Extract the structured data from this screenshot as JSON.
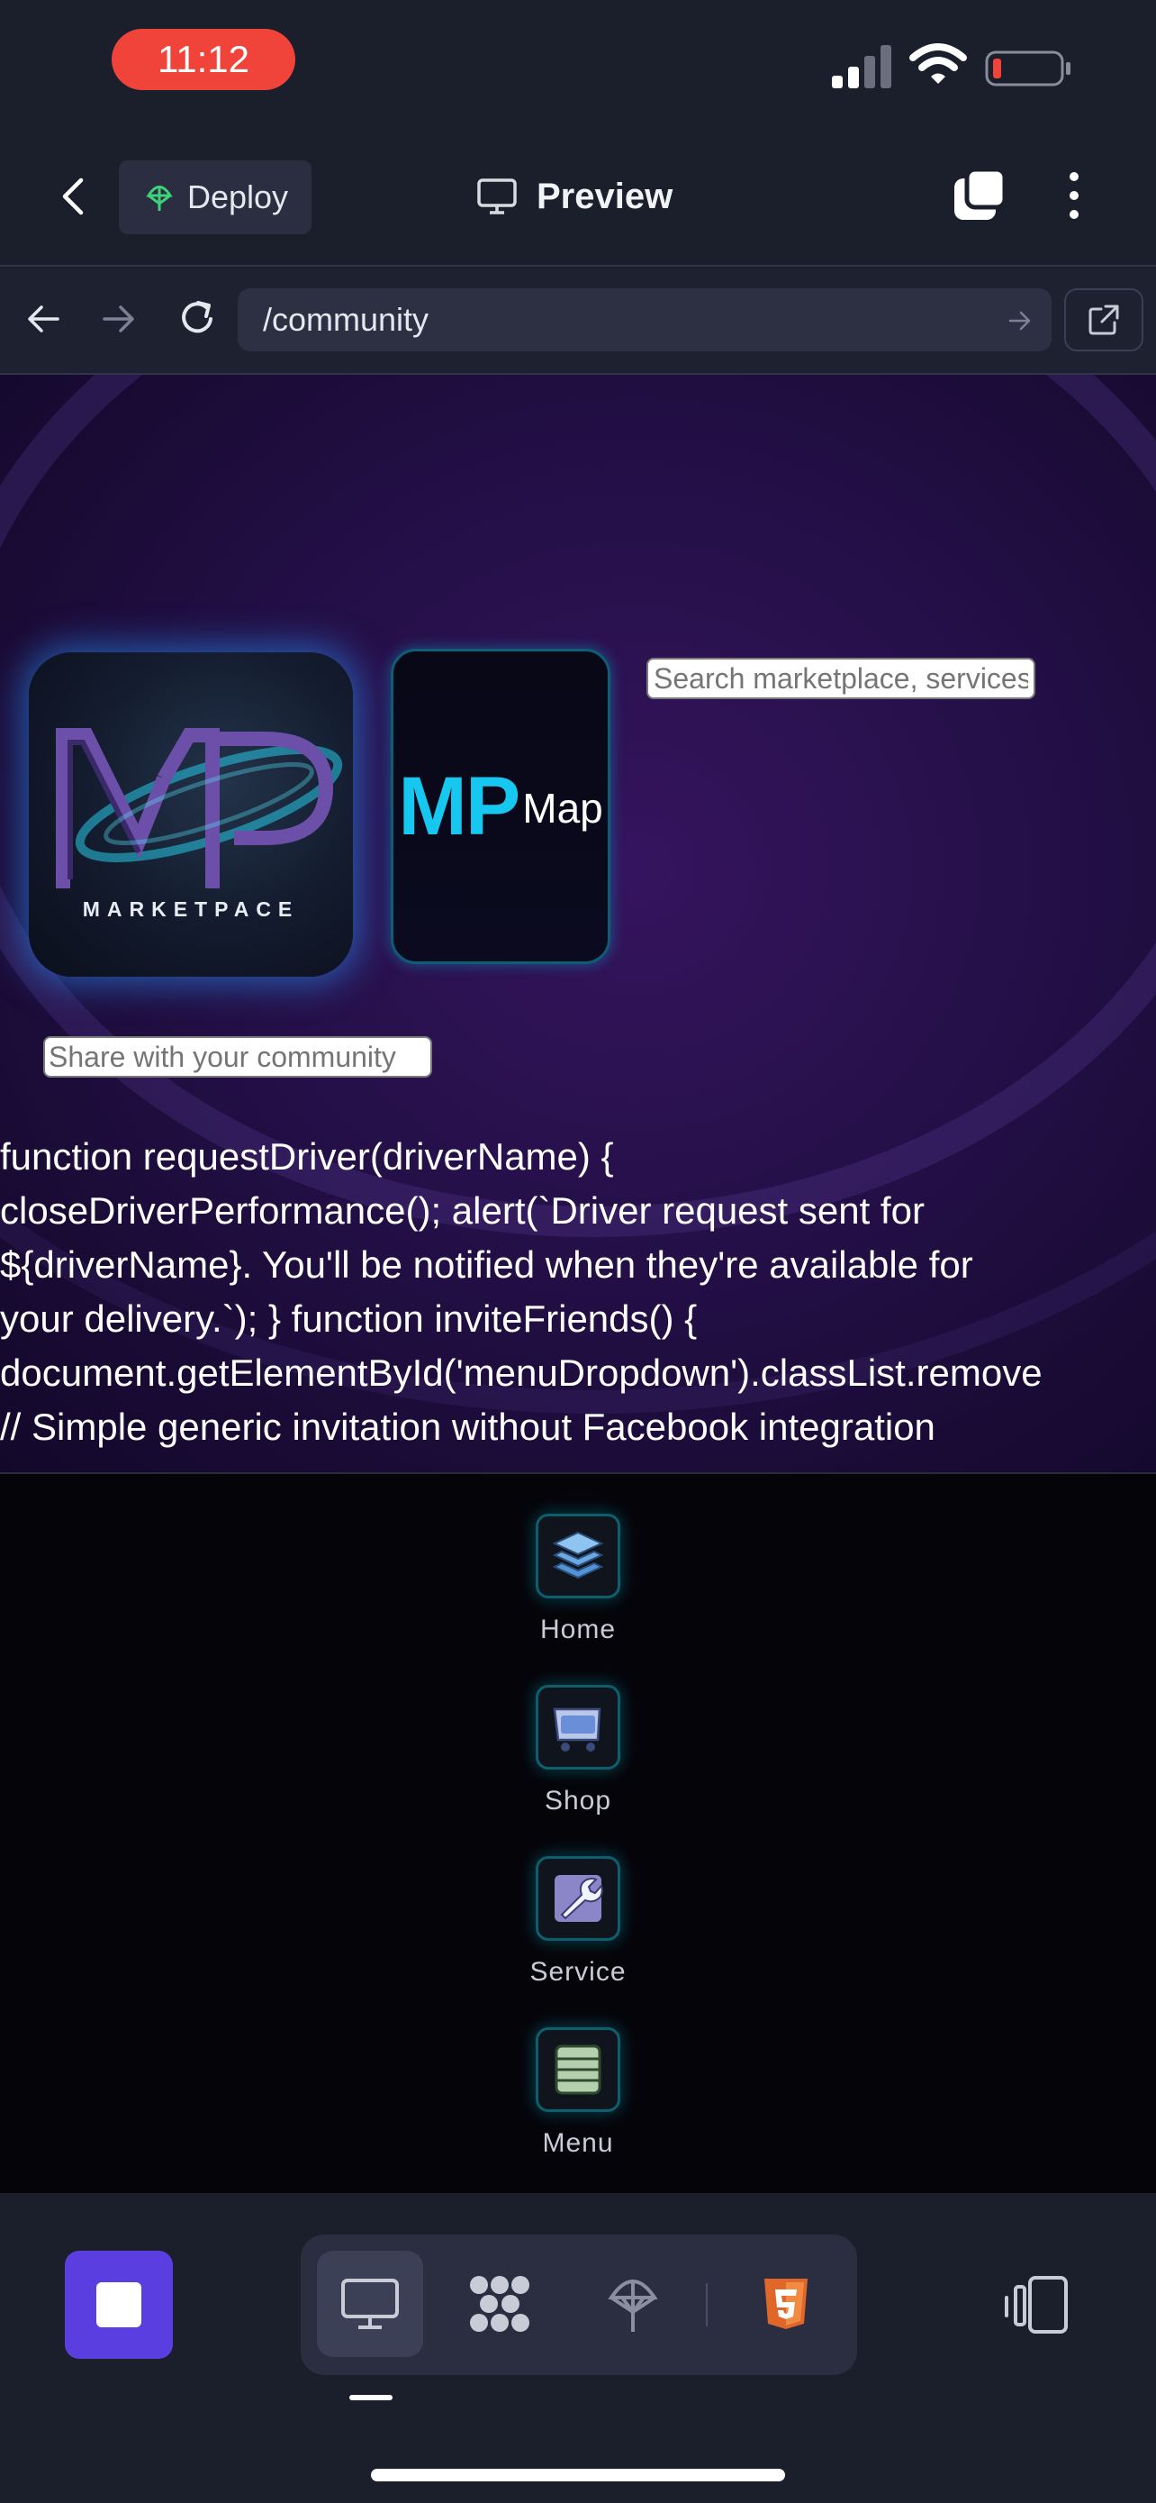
{
  "status_bar": {
    "time": "11:12"
  },
  "header": {
    "deploy_label": "Deploy",
    "title": "Preview"
  },
  "browser": {
    "url": "/community"
  },
  "page": {
    "search_placeholder": "Search marketplace, services...",
    "share_placeholder": "Share with your community",
    "logo_text": "MARKETPACE",
    "map_card": {
      "mp": "MP",
      "label": "Map"
    },
    "code_lines": [
      "function requestDriver(driverName) {",
      "closeDriverPerformance(); alert(`Driver request sent for",
      "${driverName}. You'll be notified when they're available for",
      "your delivery.`); } function inviteFriends() {",
      "document.getElementById('menuDropdown').classList.remove",
      "// Simple generic invitation without Facebook integration"
    ]
  },
  "nav": {
    "items": [
      {
        "label": "Home",
        "icon": "layers-icon"
      },
      {
        "label": "Shop",
        "icon": "cart-icon"
      },
      {
        "label": "Service",
        "icon": "wrench-icon"
      },
      {
        "label": "Menu",
        "icon": "menu-list-icon"
      }
    ]
  },
  "toolbar": {
    "tools": [
      "desktop-icon",
      "nodes-icon",
      "deploy-icon",
      "html5-icon"
    ],
    "active_tool": "desktop-icon"
  },
  "colors": {
    "accent": "#5b3ee0",
    "cyan": "#16c8ef",
    "time_pill": "#f0443a"
  }
}
